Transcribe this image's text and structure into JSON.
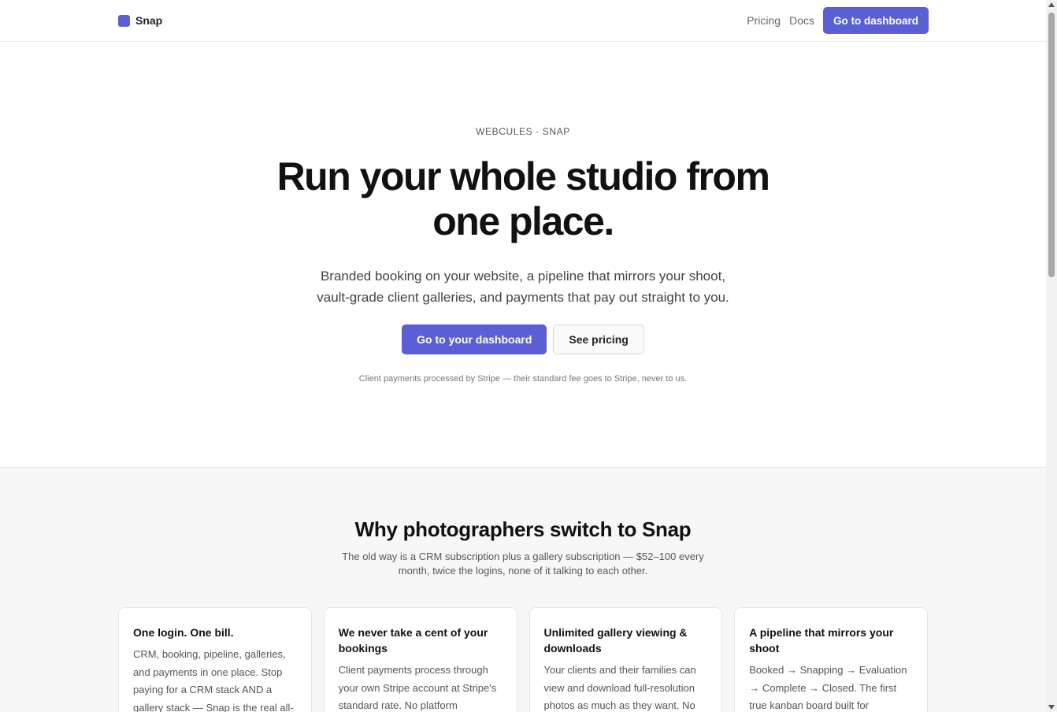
{
  "header": {
    "brand": "Snap",
    "nav": {
      "pricing": "Pricing",
      "docs": "Docs",
      "dashboard_button": "Go to dashboard"
    }
  },
  "hero": {
    "eyebrow": "WEBCULES · SNAP",
    "headline": "Run your whole studio from one place.",
    "subhead": "Branded booking on your website, a pipeline that mirrors your shoot, vault-grade client galleries, and payments that pay out straight to you.",
    "primary_cta": "Go to your dashboard",
    "secondary_cta": "See pricing",
    "fineprint": "Client payments processed by Stripe — their standard fee goes to Stripe, never to us."
  },
  "features": {
    "title": "Why photographers switch to Snap",
    "lead": "The old way is a CRM subscription plus a gallery subscription — $52–100 every month, twice the logins, none of it talking to each other.",
    "cards": [
      {
        "title": "One login. One bill.",
        "body": "CRM, booking, pipeline, galleries, and payments in one place. Stop paying for a CRM stack AND a gallery stack — Snap is the real all-"
      },
      {
        "title": "We never take a cent of your bookings",
        "body": "Client payments process through your own Stripe account at Stripe's standard rate. No platform"
      },
      {
        "title": "Unlimited gallery viewing & downloads",
        "body": "Your clients and their families can view and download full-resolution photos as much as they want. No"
      },
      {
        "title": "A pipeline that mirrors your shoot",
        "body": "Booked → Snapping → Evaluation → Complete → Closed. The first true kanban board built for"
      }
    ]
  },
  "colors": {
    "accent": "#5b5fd6",
    "section_bg": "#f7f7f7",
    "text": "#111111",
    "muted": "#555555"
  },
  "icons": {
    "brand_mark": "square-logo-icon",
    "scroll_up": "scroll-up-arrow-icon",
    "scroll_down": "scroll-down-arrow-icon"
  }
}
